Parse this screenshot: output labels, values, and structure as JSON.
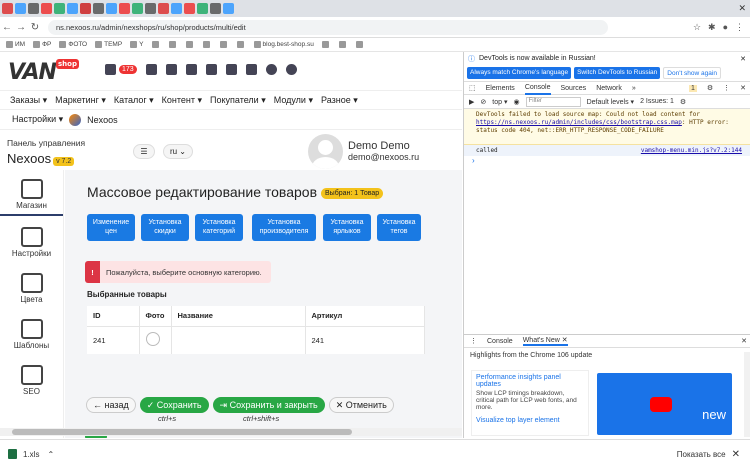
{
  "browser": {
    "url": "ns.nexoos.ru/admin/nexshops/ru/shop/products/multi/edit",
    "bookmarks": [
      "ИМ",
      "ФР",
      "ФОТО",
      "TEMP",
      "Y",
      "blog.best-shop.su"
    ]
  },
  "site": {
    "logo": "VAN",
    "logo_badge": "shop",
    "cart_count": "173",
    "menu": [
      "Заказы ▾",
      "Маркетинг ▾",
      "Каталог ▾",
      "Контент ▾",
      "Покупатели ▾",
      "Модули ▾",
      "Разное ▾"
    ],
    "menu2": [
      "Настройки ▾",
      "Nexoos"
    ],
    "panel_label": "Панель управления",
    "panel_name": "Nexoos",
    "version": "v 7.2",
    "lang": "ru ⌄",
    "user_name": "Demo Demo",
    "user_email": "demo@nexoos.ru"
  },
  "sidebar": [
    "Магазин",
    "Настройки",
    "Цвета",
    "Шаблоны",
    "SEO"
  ],
  "main": {
    "title": "Массовое редактирование товаров",
    "selected": "Выбран: 1 Товар",
    "quick_buttons": [
      "Изменение цен",
      "Установка скидки",
      "Установка категорий",
      "Установка производителя",
      "Установка ярлыков",
      "Установка тегов"
    ],
    "alert": "Пожалуйста, выберите основную категорию.",
    "section": "Выбранные товары",
    "columns": [
      "ID",
      "Фото",
      "Название",
      "Артикул"
    ],
    "row": {
      "id": "241",
      "name": "",
      "sku": "241"
    },
    "toggle_label": "Изменение цен"
  },
  "actions": {
    "back": "← назад",
    "save": "✓ Сохранить",
    "save_close": "Сохранить и закрыть",
    "cancel": "✕ Отменить",
    "hint_save": "ctrl+s",
    "hint_save_close": "ctrl+shift+s"
  },
  "devtools": {
    "info": "DevTools is now available in Russian!",
    "btn1": "Always match Chrome's language",
    "btn2": "Switch DevTools to Russian",
    "btn3": "Don't show again",
    "tabs": [
      "Elements",
      "Console",
      "Sources",
      "Network"
    ],
    "badge": "1",
    "context": "top ▾",
    "filter": "Filter",
    "levels": "Default levels ▾",
    "issues": "2 Issues: 1",
    "warning_prefix": "DevTools failed to load source map: Could not load content for ",
    "warning_link": "https://ns.nexoos.ru/admin/includes/css/bootstrap.css.map",
    "warning_suffix": ": HTTP error: status code 404, net::ERR_HTTP_RESPONSE_CODE_FAILURE",
    "called": "called",
    "ref": "vamshop-menu.min.js?v7.2:144",
    "drawer_tabs": [
      "Console",
      "What's New ✕"
    ],
    "highlights": "Highlights from the Chrome 106 update",
    "card_title": "Performance insights panel updates",
    "card_text": "Show LCP timings breakdown, critical path for LCP web fonts, and more.",
    "card2": "Visualize top layer element",
    "video_text": "new"
  },
  "download": {
    "file": "1.xls",
    "show_all": "Показать все",
    "close": "✕"
  }
}
